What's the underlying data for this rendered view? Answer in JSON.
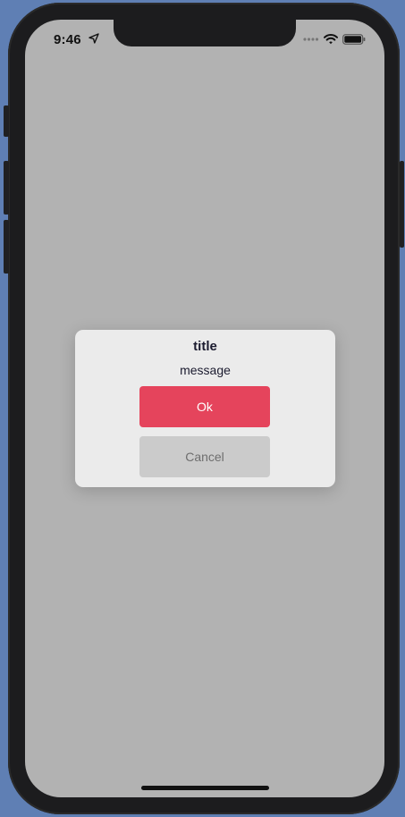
{
  "status_bar": {
    "time": "9:46",
    "icons": [
      "location-arrow-icon",
      "cellular-signal-icon",
      "wifi-icon",
      "battery-icon"
    ]
  },
  "dialog": {
    "title": "title",
    "message": "message",
    "ok_label": "Ok",
    "cancel_label": "Cancel"
  },
  "colors": {
    "overlay": "#b2b2b2",
    "dialog_background": "#ebebeb",
    "ok_button": "#e5445c",
    "cancel_button": "#cbcbcb",
    "text": "#1b1b2f"
  }
}
